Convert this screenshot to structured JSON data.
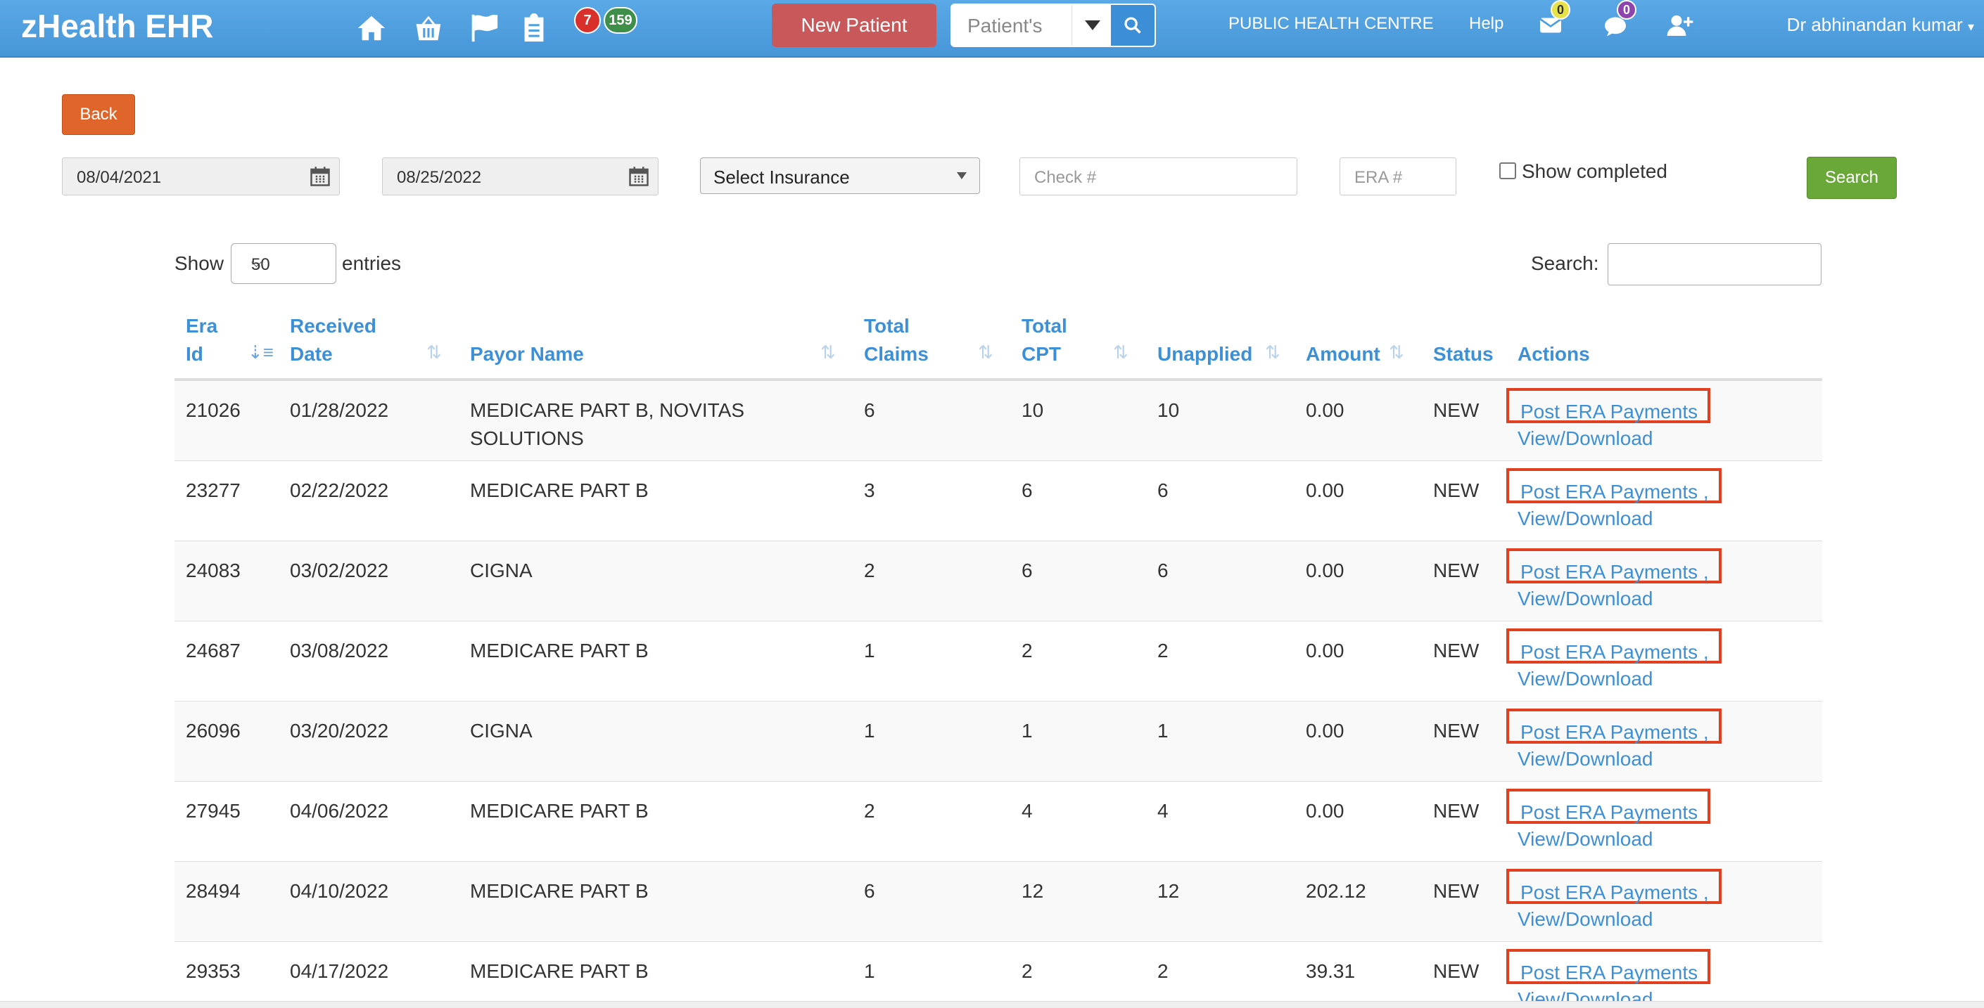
{
  "app": {
    "title": "zHealth EHR",
    "badges": {
      "red": "7",
      "green": "159"
    },
    "new_patient": "New Patient",
    "patient_search_placeholder": "Patient's",
    "facility": "PUBLIC HEALTH CENTRE",
    "help": "Help",
    "mail_count": "0",
    "chat_count": "0",
    "user": "Dr abhinandan kumar"
  },
  "filters": {
    "back": "Back",
    "from_date": "08/04/2021",
    "to_date": "08/25/2022",
    "insurance": "Select Insurance",
    "check_placeholder": "Check #",
    "era_placeholder": "ERA #",
    "show_completed": "Show completed",
    "search": "Search"
  },
  "table_controls": {
    "show": "Show",
    "length": "50",
    "entries": "entries",
    "search_label": "Search:"
  },
  "headers": {
    "era_id_1": "Era",
    "era_id_2": "Id",
    "received_1": "Received",
    "received_2": "Date",
    "payor": "Payor Name",
    "claims_1": "Total",
    "claims_2": "Claims",
    "cpt_1": "Total",
    "cpt_2": "CPT",
    "unapplied": "Unapplied",
    "amount": "Amount",
    "status": "Status",
    "actions": "Actions"
  },
  "rows": [
    {
      "era_id": "21026",
      "date": "01/28/2022",
      "payor_1": "MEDICARE PART B, NOVITAS",
      "payor_2": "SOLUTIONS",
      "claims": "6",
      "cpt": "10",
      "unapplied": "10",
      "amount": "0.00",
      "status": "NEW",
      "post": "Post ERA Payments",
      "view": "View/Download"
    },
    {
      "era_id": "23277",
      "date": "02/22/2022",
      "payor_1": "MEDICARE PART B",
      "payor_2": "",
      "claims": "3",
      "cpt": "6",
      "unapplied": "6",
      "amount": "0.00",
      "status": "NEW",
      "post": "Post ERA Payments ,",
      "view": "View/Download"
    },
    {
      "era_id": "24083",
      "date": "03/02/2022",
      "payor_1": "CIGNA",
      "payor_2": "",
      "claims": "2",
      "cpt": "6",
      "unapplied": "6",
      "amount": "0.00",
      "status": "NEW",
      "post": "Post ERA Payments ,",
      "view": "View/Download"
    },
    {
      "era_id": "24687",
      "date": "03/08/2022",
      "payor_1": "MEDICARE PART B",
      "payor_2": "",
      "claims": "1",
      "cpt": "2",
      "unapplied": "2",
      "amount": "0.00",
      "status": "NEW",
      "post": "Post ERA Payments ,",
      "view": "View/Download"
    },
    {
      "era_id": "26096",
      "date": "03/20/2022",
      "payor_1": "CIGNA",
      "payor_2": "",
      "claims": "1",
      "cpt": "1",
      "unapplied": "1",
      "amount": "0.00",
      "status": "NEW",
      "post": "Post ERA Payments ,",
      "view": "View/Download"
    },
    {
      "era_id": "27945",
      "date": "04/06/2022",
      "payor_1": "MEDICARE PART B",
      "payor_2": "",
      "claims": "2",
      "cpt": "4",
      "unapplied": "4",
      "amount": "0.00",
      "status": "NEW",
      "post": "Post ERA Payments",
      "view": "View/Download"
    },
    {
      "era_id": "28494",
      "date": "04/10/2022",
      "payor_1": "MEDICARE PART B",
      "payor_2": "",
      "claims": "6",
      "cpt": "12",
      "unapplied": "12",
      "amount": "202.12",
      "status": "NEW",
      "post": "Post ERA Payments ,",
      "view": "View/Download"
    },
    {
      "era_id": "29353",
      "date": "04/17/2022",
      "payor_1": "MEDICARE PART B",
      "payor_2": "",
      "claims": "1",
      "cpt": "2",
      "unapplied": "2",
      "amount": "39.31",
      "status": "NEW",
      "post": "Post ERA Payments",
      "view": "View/Download"
    }
  ]
}
